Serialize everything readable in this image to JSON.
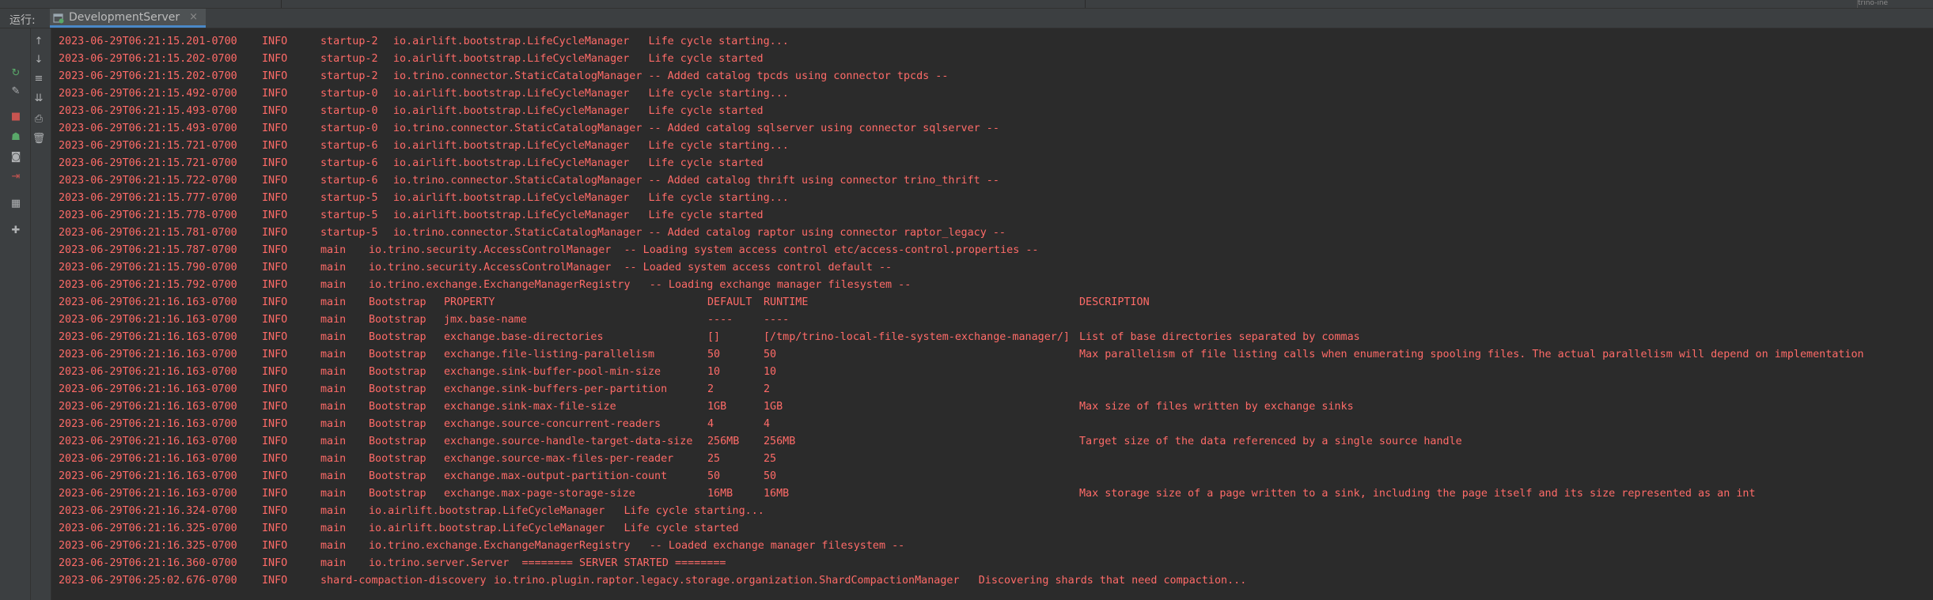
{
  "window": {
    "top_right_text": "trino-ine"
  },
  "run_panel": {
    "label": "运行:",
    "tab": {
      "label": "DevelopmentServer",
      "close": "×"
    }
  },
  "colors": {
    "log_text": "#ff6b68",
    "background": "#2b2b2b",
    "panel": "#3c3f41",
    "tab_underline": "#4a88c7"
  },
  "toolbar": {
    "left_col": [
      {
        "name": "rerun-icon",
        "glyph": "↻",
        "color": "#59a869"
      },
      {
        "name": "wrench-icon",
        "glyph": "✎",
        "color": "#afb1b3"
      },
      {
        "name": "stop-icon",
        "glyph": "■",
        "color": "#c75450"
      },
      {
        "name": "debug-icon",
        "glyph": "☗",
        "color": "#59a869"
      },
      {
        "name": "camera-icon",
        "glyph": "◙",
        "color": "#afb1b3"
      },
      {
        "name": "exit-icon",
        "glyph": "⇥",
        "color": "#c75450"
      },
      {
        "name": "layout-icon",
        "glyph": "▦",
        "color": "#afb1b3"
      },
      {
        "name": "pin-icon",
        "glyph": "✚",
        "color": "#afb1b3"
      }
    ],
    "right_col": [
      {
        "name": "scroll-up-icon",
        "glyph": "↑",
        "color": "#afb1b3"
      },
      {
        "name": "scroll-down-icon",
        "glyph": "↓",
        "color": "#afb1b3"
      },
      {
        "name": "soft-wrap-icon",
        "glyph": "≡",
        "color": "#afb1b3"
      },
      {
        "name": "scroll-to-end-icon",
        "glyph": "⇊",
        "color": "#afb1b3"
      },
      {
        "name": "print-icon",
        "glyph": "⎙",
        "color": "#afb1b3"
      },
      {
        "name": "trash-icon",
        "glyph": "🗑",
        "color": "#afb1b3"
      }
    ]
  },
  "log_lines": [
    [
      "2023-06-29T06:21:15.201-0700",
      "INFO",
      "startup-2",
      "io.airlift.bootstrap.LifeCycleManager   Life cycle starting..."
    ],
    [
      "2023-06-29T06:21:15.202-0700",
      "INFO",
      "startup-2",
      "io.airlift.bootstrap.LifeCycleManager   Life cycle started"
    ],
    [
      "2023-06-29T06:21:15.202-0700",
      "INFO",
      "startup-2",
      "io.trino.connector.StaticCatalogManager -- Added catalog tpcds using connector tpcds --"
    ],
    [
      "2023-06-29T06:21:15.492-0700",
      "INFO",
      "startup-0",
      "io.airlift.bootstrap.LifeCycleManager   Life cycle starting..."
    ],
    [
      "2023-06-29T06:21:15.493-0700",
      "INFO",
      "startup-0",
      "io.airlift.bootstrap.LifeCycleManager   Life cycle started"
    ],
    [
      "2023-06-29T06:21:15.493-0700",
      "INFO",
      "startup-0",
      "io.trino.connector.StaticCatalogManager -- Added catalog sqlserver using connector sqlserver --"
    ],
    [
      "2023-06-29T06:21:15.721-0700",
      "INFO",
      "startup-6",
      "io.airlift.bootstrap.LifeCycleManager   Life cycle starting..."
    ],
    [
      "2023-06-29T06:21:15.721-0700",
      "INFO",
      "startup-6",
      "io.airlift.bootstrap.LifeCycleManager   Life cycle started"
    ],
    [
      "2023-06-29T06:21:15.722-0700",
      "INFO",
      "startup-6",
      "io.trino.connector.StaticCatalogManager -- Added catalog thrift using connector trino_thrift --"
    ],
    [
      "2023-06-29T06:21:15.777-0700",
      "INFO",
      "startup-5",
      "io.airlift.bootstrap.LifeCycleManager   Life cycle starting..."
    ],
    [
      "2023-06-29T06:21:15.778-0700",
      "INFO",
      "startup-5",
      "io.airlift.bootstrap.LifeCycleManager   Life cycle started"
    ],
    [
      "2023-06-29T06:21:15.781-0700",
      "INFO",
      "startup-5",
      "io.trino.connector.StaticCatalogManager -- Added catalog raptor using connector raptor_legacy --"
    ],
    [
      "2023-06-29T06:21:15.787-0700",
      "INFO",
      "main",
      "io.trino.security.AccessControlManager  -- Loading system access control etc/access-control.properties --"
    ],
    [
      "2023-06-29T06:21:15.790-0700",
      "INFO",
      "main",
      "io.trino.security.AccessControlManager  -- Loaded system access control default --"
    ],
    [
      "2023-06-29T06:21:15.792-0700",
      "INFO",
      "main",
      "io.trino.exchange.ExchangeManagerRegistry   -- Loading exchange manager filesystem --"
    ],
    [
      "2023-06-29T06:21:16.163-0700",
      "INFO",
      "main",
      "Bootstrap",
      "PROPERTY",
      "DEFAULT",
      "RUNTIME",
      "DESCRIPTION"
    ],
    [
      "2023-06-29T06:21:16.163-0700",
      "INFO",
      "main",
      "Bootstrap",
      "jmx.base-name",
      "----",
      "----",
      ""
    ],
    [
      "2023-06-29T06:21:16.163-0700",
      "INFO",
      "main",
      "Bootstrap",
      "exchange.base-directories",
      "[]",
      "[/tmp/trino-local-file-system-exchange-manager/]",
      "List of base directories separated by commas"
    ],
    [
      "2023-06-29T06:21:16.163-0700",
      "INFO",
      "main",
      "Bootstrap",
      "exchange.file-listing-parallelism",
      "50",
      "50",
      "Max parallelism of file listing calls when enumerating spooling files. The actual parallelism will depend on implementation"
    ],
    [
      "2023-06-29T06:21:16.163-0700",
      "INFO",
      "main",
      "Bootstrap",
      "exchange.sink-buffer-pool-min-size",
      "10",
      "10",
      ""
    ],
    [
      "2023-06-29T06:21:16.163-0700",
      "INFO",
      "main",
      "Bootstrap",
      "exchange.sink-buffers-per-partition",
      "2",
      "2",
      ""
    ],
    [
      "2023-06-29T06:21:16.163-0700",
      "INFO",
      "main",
      "Bootstrap",
      "exchange.sink-max-file-size",
      "1GB",
      "1GB",
      "Max size of files written by exchange sinks"
    ],
    [
      "2023-06-29T06:21:16.163-0700",
      "INFO",
      "main",
      "Bootstrap",
      "exchange.source-concurrent-readers",
      "4",
      "4",
      ""
    ],
    [
      "2023-06-29T06:21:16.163-0700",
      "INFO",
      "main",
      "Bootstrap",
      "exchange.source-handle-target-data-size",
      "256MB",
      "256MB",
      "Target size of the data referenced by a single source handle"
    ],
    [
      "2023-06-29T06:21:16.163-0700",
      "INFO",
      "main",
      "Bootstrap",
      "exchange.source-max-files-per-reader",
      "25",
      "25",
      ""
    ],
    [
      "2023-06-29T06:21:16.163-0700",
      "INFO",
      "main",
      "Bootstrap",
      "exchange.max-output-partition-count",
      "50",
      "50",
      ""
    ],
    [
      "2023-06-29T06:21:16.163-0700",
      "INFO",
      "main",
      "Bootstrap",
      "exchange.max-page-storage-size",
      "16MB",
      "16MB",
      "Max storage size of a page written to a sink, including the page itself and its size represented as an int"
    ],
    [
      "2023-06-29T06:21:16.324-0700",
      "INFO",
      "main",
      "io.airlift.bootstrap.LifeCycleManager   Life cycle starting..."
    ],
    [
      "2023-06-29T06:21:16.325-0700",
      "INFO",
      "main",
      "io.airlift.bootstrap.LifeCycleManager   Life cycle started"
    ],
    [
      "2023-06-29T06:21:16.325-0700",
      "INFO",
      "main",
      "io.trino.exchange.ExchangeManagerRegistry   -- Loaded exchange manager filesystem --"
    ],
    [
      "2023-06-29T06:21:16.360-0700",
      "INFO",
      "main",
      "io.trino.server.Server  ======== SERVER STARTED ========"
    ],
    [
      "2023-06-29T06:25:02.676-0700",
      "INFO",
      "shard-compaction-discovery",
      "io.trino.plugin.raptor.legacy.storage.organization.ShardCompactionManager   Discovering shards that need compaction..."
    ]
  ]
}
